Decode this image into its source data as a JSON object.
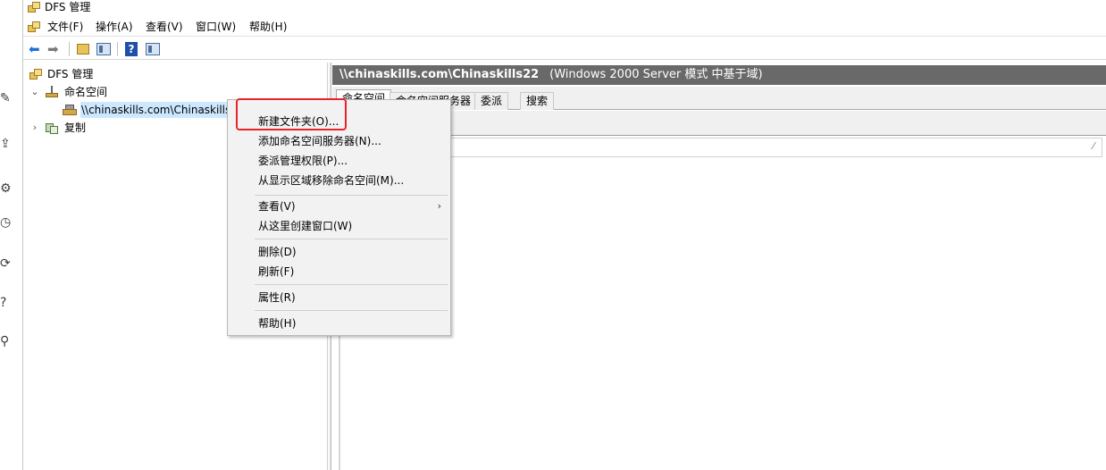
{
  "window": {
    "title": "DFS 管理"
  },
  "menubar": {
    "items": [
      "文件(F)",
      "操作(A)",
      "查看(V)",
      "窗口(W)",
      "帮助(H)"
    ]
  },
  "toolbar": {
    "icons": [
      "back-arrow-icon",
      "forward-arrow-icon",
      "up-folder-icon",
      "show-hide-tree-icon",
      "help-icon",
      "action-pane-icon"
    ]
  },
  "tree": {
    "root": "DFS 管理",
    "namespaces": "命名空间",
    "selected_namespace": "\\\\chinaskills.com\\Chinaskills22",
    "replication": "复制"
  },
  "right": {
    "header_path": "\\\\chinaskills.com\\Chinaskills22",
    "header_mode": "(Windows 2000 Server 模式 中基于域)",
    "tabs": [
      "命名空间",
      "命名空间服务器",
      "委派",
      "搜索"
    ],
    "active_tab": "命名空间"
  },
  "context_menu": {
    "items": [
      "新建文件夹(O)...",
      "添加命名空间服务器(N)...",
      "委派管理权限(P)...",
      "从显示区域移除命名空间(M)...",
      "查看(V)",
      "从这里创建窗口(W)",
      "删除(D)",
      "刷新(F)",
      "属性(R)",
      "帮助(H)"
    ],
    "highlighted_item": "新建文件夹(O)...",
    "highlight_color": "#e8232a"
  },
  "colors": {
    "header_bg": "#696969",
    "selection": "#cce8ff"
  }
}
